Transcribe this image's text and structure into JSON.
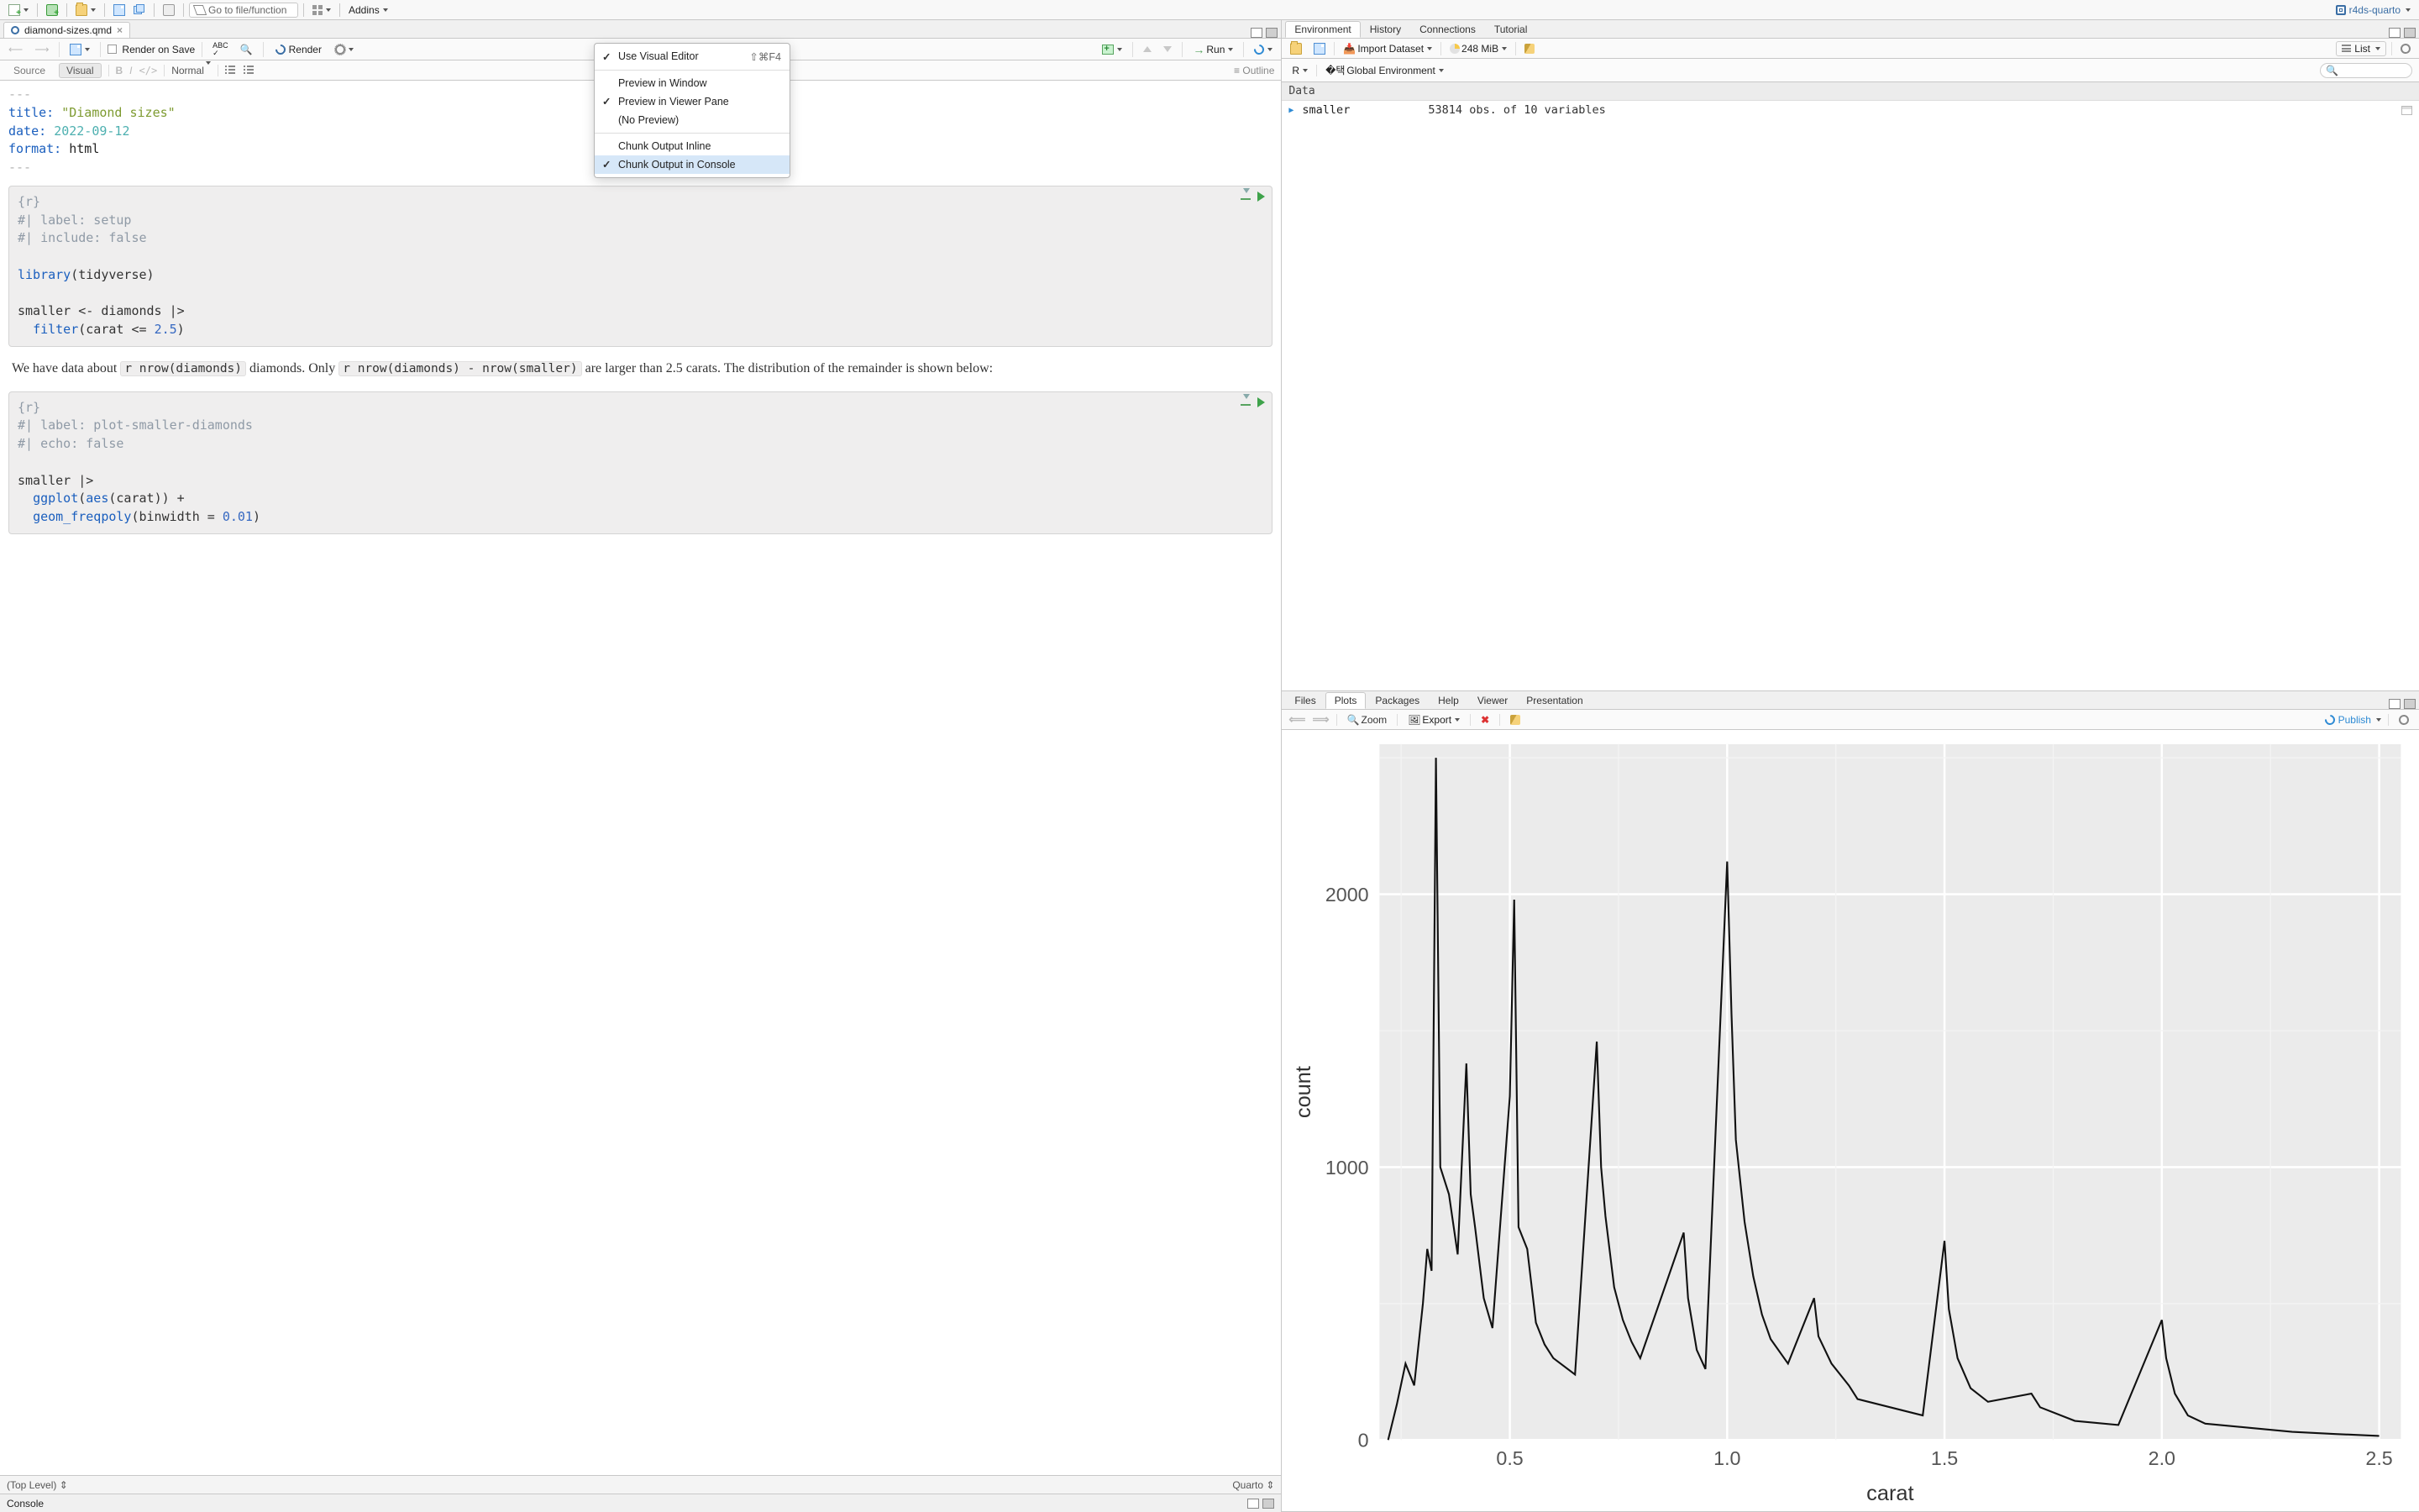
{
  "app_toolbar": {
    "goto_placeholder": "Go to file/function",
    "addins_label": "Addins",
    "project_name": "r4ds-quarto"
  },
  "source": {
    "tab": "diamond-sizes.qmd",
    "toolbar": {
      "render_on_save": "Render on Save",
      "render": "Render",
      "run": "Run"
    },
    "format_bar": {
      "source": "Source",
      "visual": "Visual",
      "style": "Normal",
      "outline": "Outline",
      "bold": "B",
      "italic": "I",
      "code": "</>"
    },
    "gear_menu": {
      "use_visual": "Use Visual Editor",
      "use_visual_short": "⇧⌘F4",
      "preview_window": "Preview in Window",
      "preview_viewer": "Preview in Viewer Pane",
      "no_preview": "(No Preview)",
      "chunk_inline": "Chunk Output Inline",
      "chunk_console": "Chunk Output in Console"
    },
    "yaml": {
      "title_key": "title:",
      "title_val": "\"Diamond sizes\"",
      "date_key": "date:",
      "date_val": "2022-09-12",
      "format_key": "format:",
      "format_val": "html",
      "dashes": "---"
    },
    "chunk1": {
      "open": "{r}",
      "l1": "#| label: setup",
      "l2": "#| include: false",
      "lib_fn": "library",
      "lib_arg": "tidyverse",
      "assign_lhs": "smaller",
      "assign_op": "<-",
      "assign_rhs": "diamonds",
      "pipe": "|>",
      "filter_fn": "filter",
      "filter_arg1": "carat",
      "filter_op": "<=",
      "filter_num": "2.5"
    },
    "prose": {
      "p1a": "We have data about ",
      "c1": "r nrow(diamonds)",
      "p1b": " diamonds. Only ",
      "c2": "r nrow(diamonds) - nrow(smaller)",
      "p1c": " are larger than 2.5 carats. The distribution of the remainder is shown below:"
    },
    "chunk2": {
      "open": "{r}",
      "l1": "#| label: plot-smaller-diamonds",
      "l2": "#| echo: false",
      "p1": "smaller",
      "pipe": "|>",
      "gg": "ggplot",
      "aes": "aes",
      "aes_arg": "carat",
      "geom": "geom_freqpoly",
      "bw_key": "binwidth",
      "bw_eq": "=",
      "bw_val": "0.01"
    },
    "status_left": "(Top Level)",
    "status_right": "Quarto"
  },
  "console_tab": "Console",
  "env_panel": {
    "tabs": [
      "Environment",
      "History",
      "Connections",
      "Tutorial"
    ],
    "import": "Import Dataset",
    "mem": "248 MiB",
    "view_mode": "List",
    "scope_r": "R",
    "scope_env": "Global Environment",
    "section": "Data",
    "row_name": "smaller",
    "row_desc": "53814 obs. of 10 variables"
  },
  "plots_panel": {
    "tabs": [
      "Files",
      "Plots",
      "Packages",
      "Help",
      "Viewer",
      "Presentation"
    ],
    "zoom": "Zoom",
    "export": "Export",
    "publish": "Publish"
  },
  "chart_data": {
    "type": "line",
    "title": "",
    "xlabel": "carat",
    "ylabel": "count",
    "xlim": [
      0.2,
      2.55
    ],
    "ylim": [
      0,
      2550
    ],
    "x_ticks": [
      0.5,
      1.0,
      1.5,
      2.0,
      2.5
    ],
    "y_ticks": [
      0,
      1000,
      2000
    ],
    "series": [
      {
        "name": "freqpoly",
        "points": [
          [
            0.22,
            0
          ],
          [
            0.24,
            130
          ],
          [
            0.26,
            280
          ],
          [
            0.28,
            200
          ],
          [
            0.3,
            500
          ],
          [
            0.31,
            700
          ],
          [
            0.32,
            620
          ],
          [
            0.33,
            2500
          ],
          [
            0.34,
            1000
          ],
          [
            0.36,
            900
          ],
          [
            0.38,
            680
          ],
          [
            0.4,
            1380
          ],
          [
            0.41,
            900
          ],
          [
            0.42,
            780
          ],
          [
            0.44,
            520
          ],
          [
            0.46,
            410
          ],
          [
            0.5,
            1260
          ],
          [
            0.51,
            1980
          ],
          [
            0.52,
            780
          ],
          [
            0.54,
            700
          ],
          [
            0.56,
            430
          ],
          [
            0.58,
            350
          ],
          [
            0.6,
            300
          ],
          [
            0.65,
            240
          ],
          [
            0.7,
            1460
          ],
          [
            0.71,
            1000
          ],
          [
            0.72,
            820
          ],
          [
            0.74,
            560
          ],
          [
            0.76,
            440
          ],
          [
            0.78,
            360
          ],
          [
            0.8,
            300
          ],
          [
            0.9,
            760
          ],
          [
            0.91,
            520
          ],
          [
            0.93,
            330
          ],
          [
            0.95,
            260
          ],
          [
            1.0,
            2120
          ],
          [
            1.01,
            1560
          ],
          [
            1.02,
            1100
          ],
          [
            1.04,
            800
          ],
          [
            1.06,
            600
          ],
          [
            1.08,
            460
          ],
          [
            1.1,
            370
          ],
          [
            1.14,
            280
          ],
          [
            1.2,
            520
          ],
          [
            1.21,
            380
          ],
          [
            1.24,
            280
          ],
          [
            1.28,
            200
          ],
          [
            1.3,
            150
          ],
          [
            1.4,
            110
          ],
          [
            1.45,
            90
          ],
          [
            1.5,
            730
          ],
          [
            1.51,
            480
          ],
          [
            1.53,
            300
          ],
          [
            1.56,
            190
          ],
          [
            1.6,
            140
          ],
          [
            1.7,
            170
          ],
          [
            1.72,
            120
          ],
          [
            1.8,
            70
          ],
          [
            1.9,
            55
          ],
          [
            2.0,
            440
          ],
          [
            2.01,
            300
          ],
          [
            2.03,
            170
          ],
          [
            2.06,
            90
          ],
          [
            2.1,
            60
          ],
          [
            2.2,
            45
          ],
          [
            2.3,
            30
          ],
          [
            2.4,
            22
          ],
          [
            2.5,
            15
          ]
        ]
      }
    ]
  }
}
